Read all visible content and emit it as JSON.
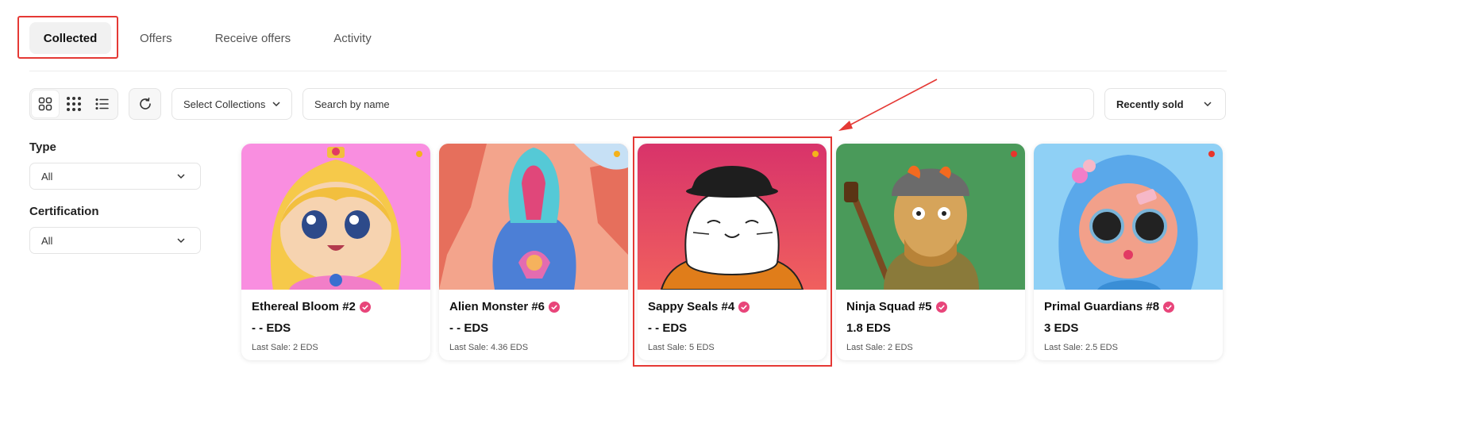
{
  "tabs": [
    {
      "label": "Collected",
      "active": true
    },
    {
      "label": "Offers",
      "active": false
    },
    {
      "label": "Receive offers",
      "active": false
    },
    {
      "label": "Activity",
      "active": false
    }
  ],
  "toolbar": {
    "view_icons": [
      "grid-large-icon",
      "grid-small-icon",
      "list-icon"
    ],
    "refresh_icon": "refresh-icon",
    "collections_label": "Select Collections",
    "search_placeholder": "Search by name",
    "sort_label": "Recently sold"
  },
  "filters": {
    "type": {
      "label": "Type",
      "value": "All"
    },
    "certification": {
      "label": "Certification",
      "value": "All"
    }
  },
  "cards": [
    {
      "title": "Ethereal Bloom #2",
      "price": "- - EDS",
      "last_sale": "Last Sale: 2 EDS",
      "bg": "#f98ee0",
      "dot": "#f5b21b"
    },
    {
      "title": "Alien Monster #6",
      "price": "- - EDS",
      "last_sale": "Last Sale: 4.36 EDS",
      "bg": "#f3a48c",
      "dot": "#f5b21b"
    },
    {
      "title": "Sappy Seals #4",
      "price": "- - EDS",
      "last_sale": "Last Sale: 5 EDS",
      "bg": "#e8496a",
      "dot": "#f5b21b"
    },
    {
      "title": "Ninja Squad #5",
      "price": "1.8 EDS",
      "last_sale": "Last Sale: 2 EDS",
      "bg": "#4a9a5a",
      "dot": "#e8352c"
    },
    {
      "title": "Primal Guardians #8",
      "price": "3 EDS",
      "last_sale": "Last Sale: 2.5 EDS",
      "bg": "#8fd0f5",
      "dot": "#e8352c"
    }
  ],
  "colors": {
    "accent": "#e53935",
    "verified": "#e8457a"
  }
}
